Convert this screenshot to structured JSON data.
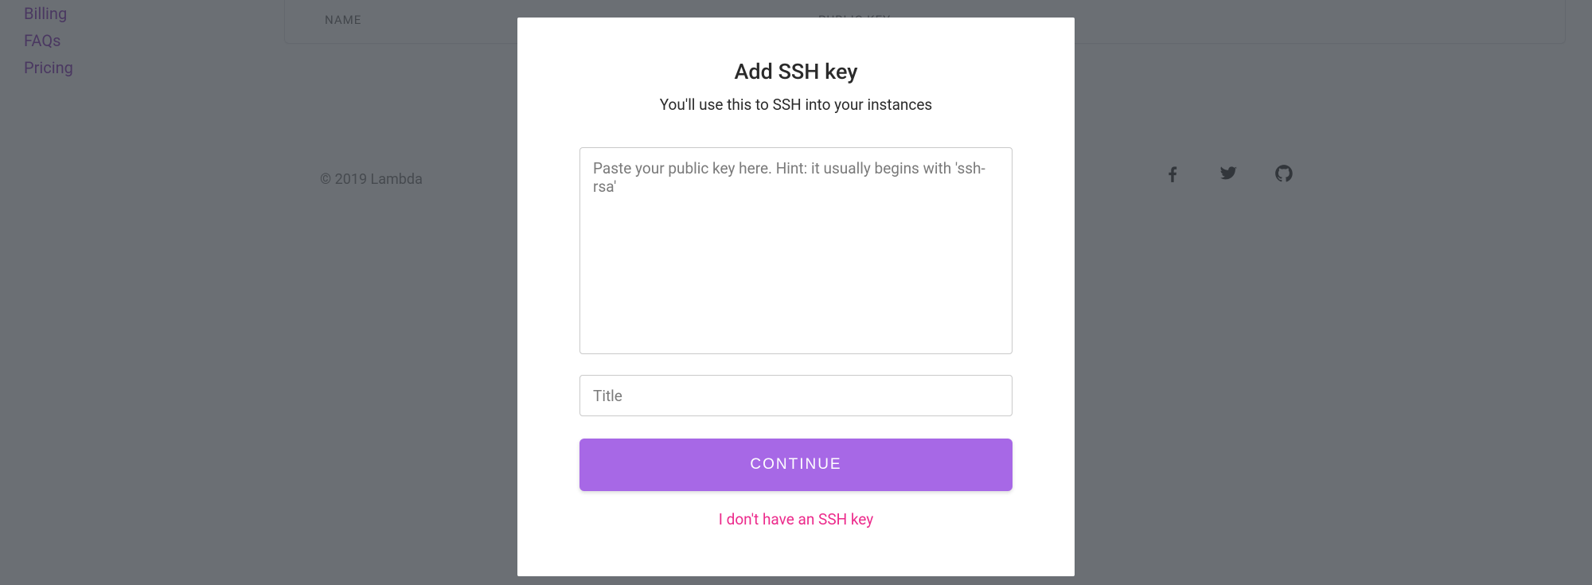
{
  "sidebar": {
    "items": [
      {
        "label": "Billing"
      },
      {
        "label": "FAQs"
      },
      {
        "label": "Pricing"
      }
    ]
  },
  "table": {
    "columns": {
      "name": "NAME",
      "public_key": "PUBLIC KEY"
    }
  },
  "footer": {
    "copyright": "© 2019 Lambda"
  },
  "social": {
    "facebook": "facebook-icon",
    "twitter": "twitter-icon",
    "github": "github-icon"
  },
  "modal": {
    "title": "Add SSH key",
    "subtitle": "You'll use this to SSH into your instances",
    "key_placeholder": "Paste your public key here. Hint: it usually begins with 'ssh-rsa'",
    "title_placeholder": "Title",
    "continue_label": "CONTINUE",
    "no_key_label": "I don't have an SSH key"
  },
  "colors": {
    "accent_purple": "#a768e6",
    "link_purple": "#8a3ab9",
    "pink": "#ec2a8b"
  }
}
